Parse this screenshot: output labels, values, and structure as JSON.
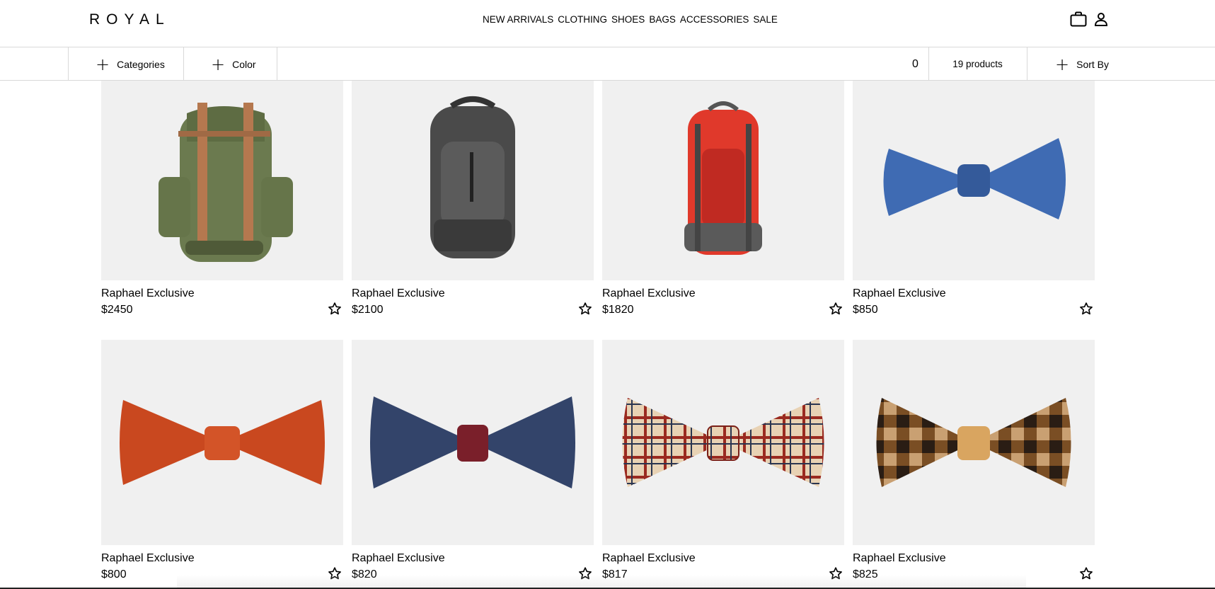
{
  "brand": {
    "logo": "ROYAL"
  },
  "nav": {
    "items": [
      "NEW ARRIVALS",
      "CLOTHING",
      "SHOES",
      "BAGS",
      "ACCESSORIES",
      "SALE"
    ]
  },
  "header_icons": {
    "cart": "shopping-bag-icon",
    "account": "user-icon"
  },
  "filters": {
    "categories_label": "Categories",
    "color_label": "Color",
    "count_value": "0",
    "products_label": "19 products",
    "sort_label": "Sort By"
  },
  "products": [
    {
      "name": "Raphael Exclusive",
      "price": "$2450",
      "image": "green-canvas-backpack"
    },
    {
      "name": "Raphael Exclusive",
      "price": "$2100",
      "image": "grey-backpack"
    },
    {
      "name": "Raphael Exclusive",
      "price": "$1820",
      "image": "red-hiking-backpack"
    },
    {
      "name": "Raphael Exclusive",
      "price": "$850",
      "image": "blue-satin-bow-tie"
    },
    {
      "name": "Raphael Exclusive",
      "price": "$800",
      "image": "orange-polka-dot-bow-tie"
    },
    {
      "name": "Raphael Exclusive",
      "price": "$820",
      "image": "navy-denim-bow-tie"
    },
    {
      "name": "Raphael Exclusive",
      "price": "$817",
      "image": "plaid-bow-tie"
    },
    {
      "name": "Raphael Exclusive",
      "price": "$825",
      "image": "brown-check-bow-tie"
    }
  ],
  "colors": {
    "image_bg": "#f0f0f0",
    "border": "#d9d9d9",
    "text": "#000000"
  }
}
